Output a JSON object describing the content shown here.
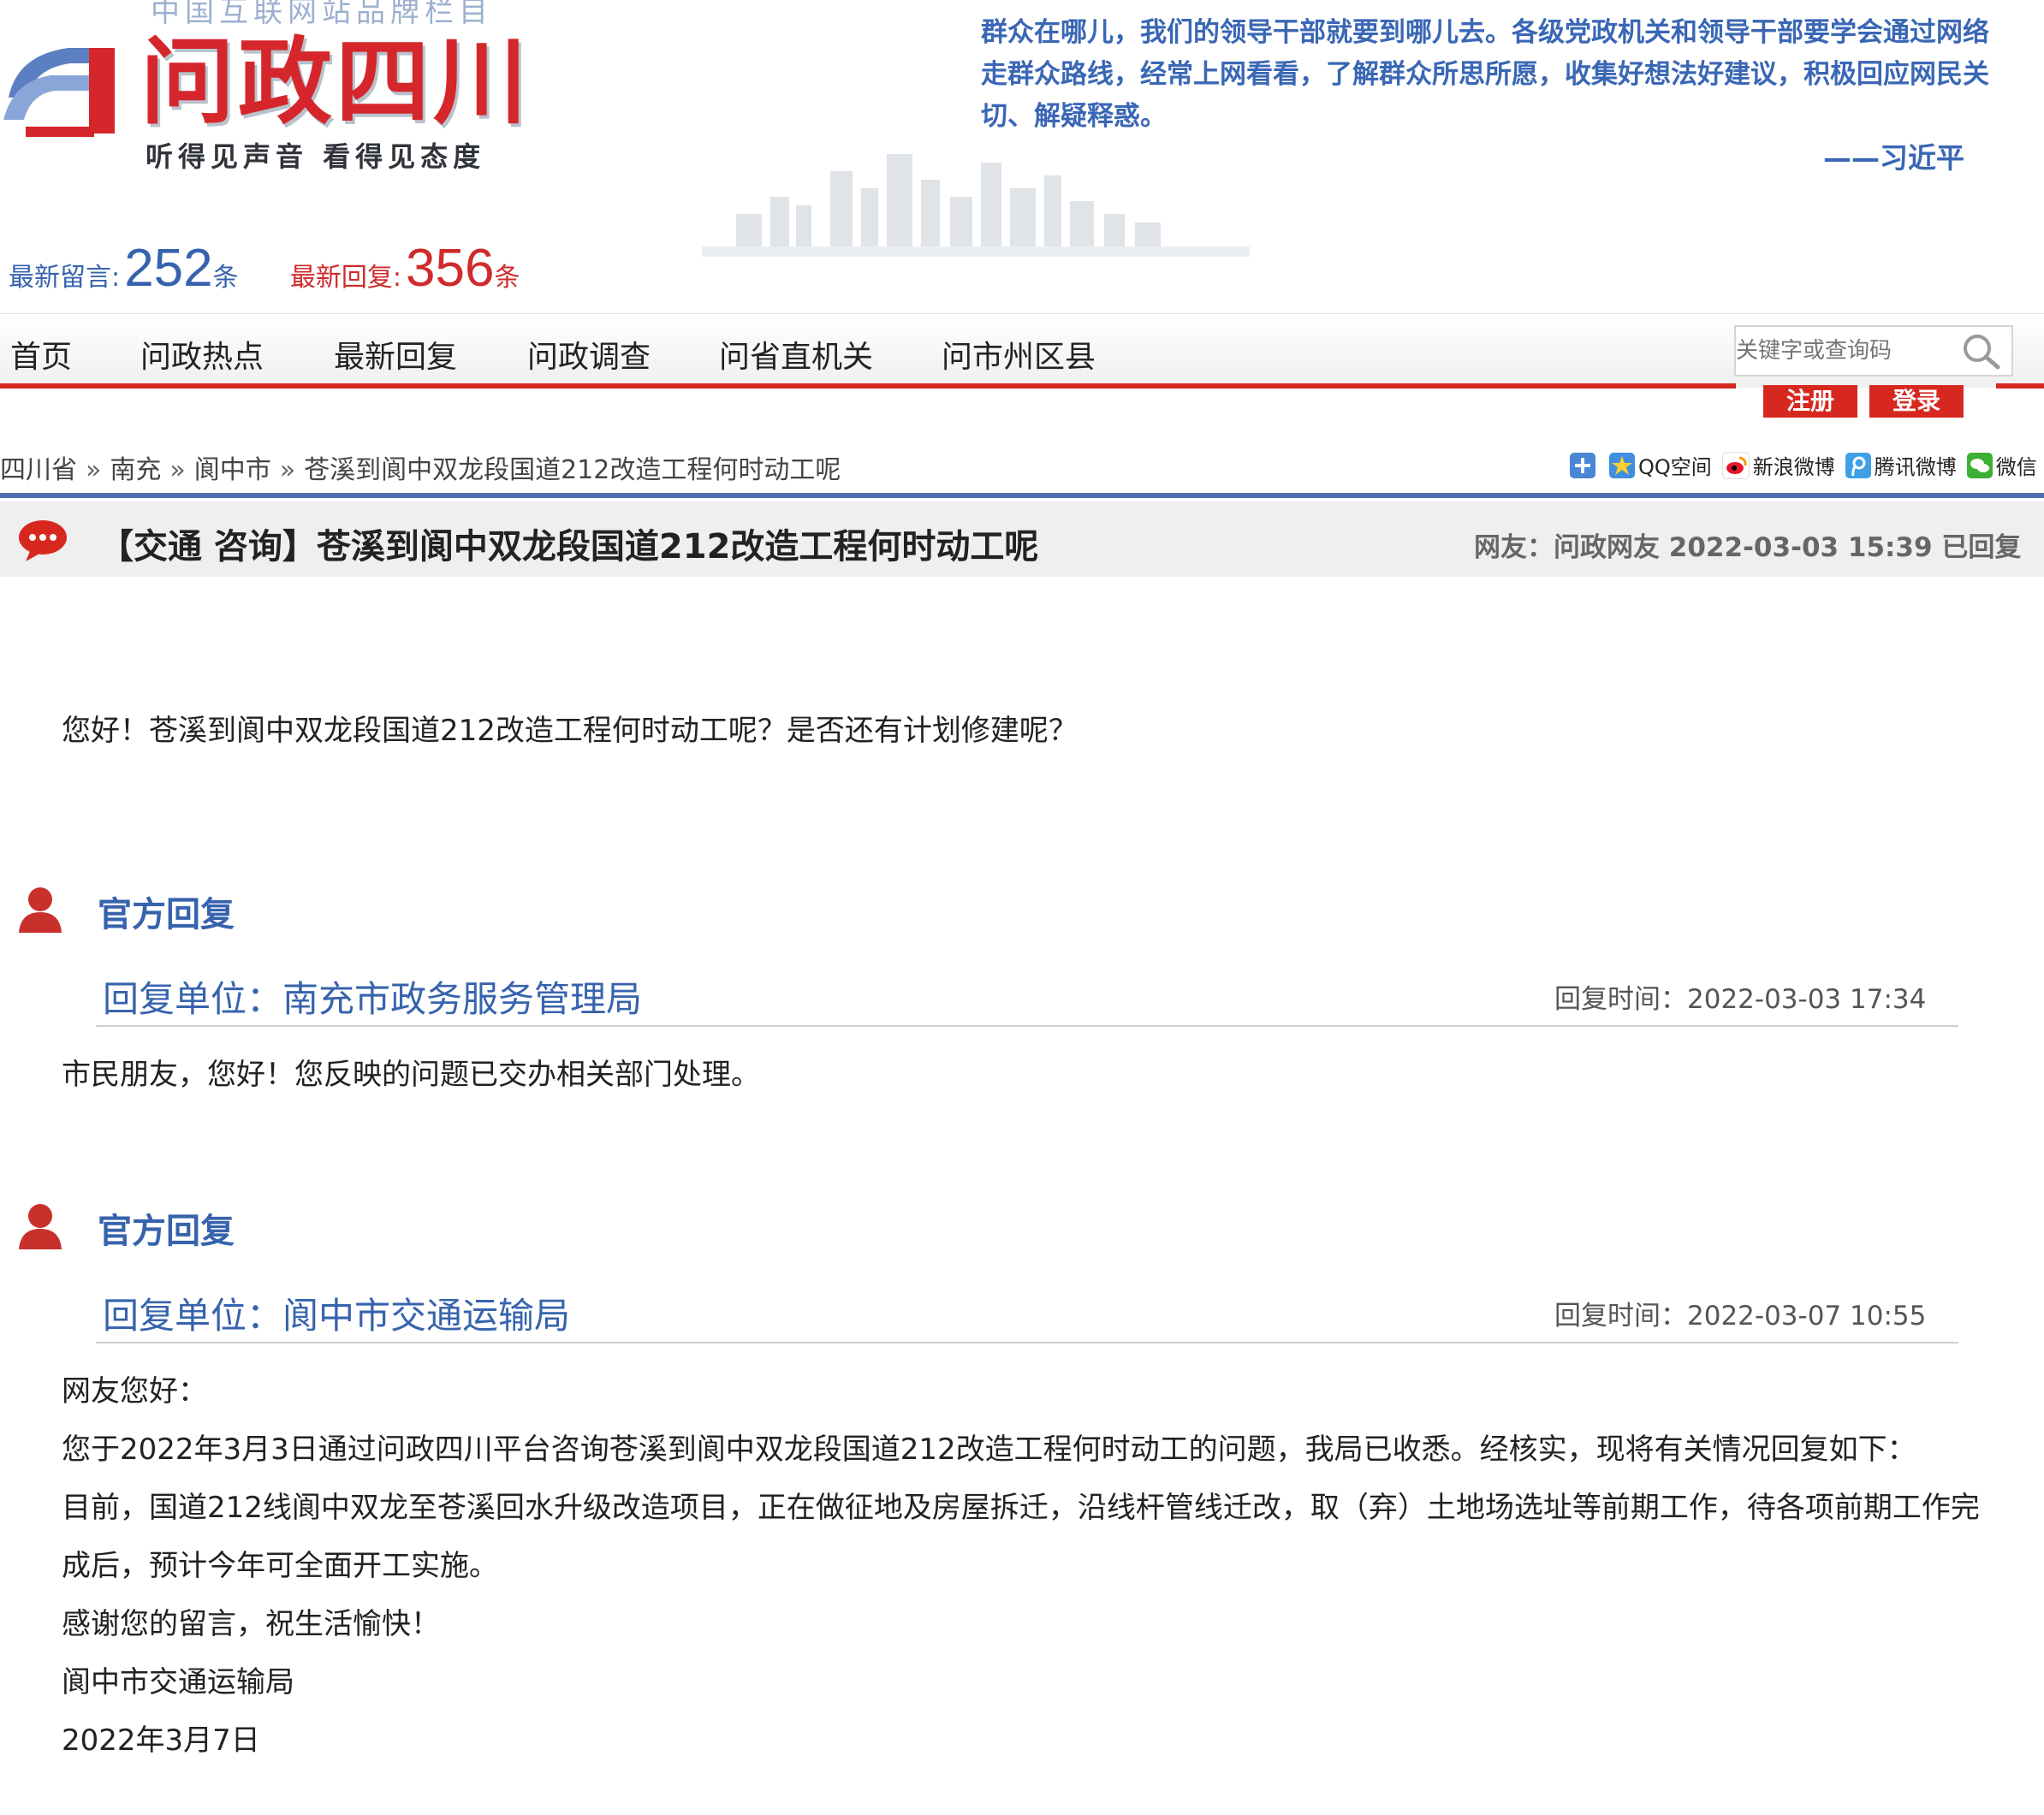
{
  "header": {
    "brand_top": "中国互联网站品牌栏目",
    "brand_title": "问政四川",
    "brand_slogan": "听得见声音  看得见态度",
    "quote": "群众在哪儿，我们的领导干部就要到哪儿去。各级党政机关和领导干部要学会通过网络走群众路线，经常上网看看，了解群众所思所愿，收集好想法好建议，积极回应网民关切、解疑释惑。",
    "quote_author": "——习近平"
  },
  "stats": {
    "messages_label": "最新留言:",
    "messages_count": "252",
    "messages_unit": "条",
    "replies_label": "最新回复:",
    "replies_count": "356",
    "replies_unit": "条"
  },
  "nav": {
    "items": [
      {
        "label": "首页"
      },
      {
        "label": "问政热点"
      },
      {
        "label": "最新回复"
      },
      {
        "label": "问政调查"
      },
      {
        "label": "问省直机关"
      },
      {
        "label": "问市州区县"
      }
    ],
    "search_placeholder": "关键字或查询码",
    "register_label": "注册",
    "login_label": "登录"
  },
  "breadcrumb": {
    "items": [
      "四川省",
      "南充",
      "阆中市",
      "苍溪到阆中双龙段国道212改造工程何时动工呢"
    ],
    "separator": "»"
  },
  "share": {
    "items": [
      {
        "label": "",
        "icon": "plus-icon"
      },
      {
        "label": "QQ空间",
        "icon": "qzone-icon"
      },
      {
        "label": "新浪微博",
        "icon": "weibo-icon"
      },
      {
        "label": "腾讯微博",
        "icon": "tencent-weibo-icon"
      },
      {
        "label": "微信",
        "icon": "wechat-icon"
      }
    ]
  },
  "post": {
    "title": "【交通 咨询】苍溪到阆中双龙段国道212改造工程何时动工呢",
    "meta": "网友：问政网友  2022-03-03 15:39 已回复",
    "question": "您好！苍溪到阆中双龙段国道212改造工程何时动工呢？是否还有计划修建呢？"
  },
  "replies": [
    {
      "head_label": "官方回复",
      "unit": "回复单位：南充市政务服务管理局",
      "time": "回复时间：2022-03-03 17:34",
      "body": [
        "市民朋友，您好！您反映的问题已交办相关部门处理。"
      ]
    },
    {
      "head_label": "官方回复",
      "unit": "回复单位：阆中市交通运输局",
      "time": "回复时间：2022-03-07 10:55",
      "body": [
        "网友您好：",
        "您于2022年3月3日通过问政四川平台咨询苍溪到阆中双龙段国道212改造工程何时动工的问题，我局已收悉。经核实，现将有关情况回复如下：",
        "目前，国道212线阆中双龙至苍溪回水升级改造项目，正在做征地及房屋拆迁，沿线杆管线迁改，取（弃）土地场选址等前期工作，待各项前期工作完成后，预计今年可全面开工实施。",
        "感谢您的留言，祝生活愉快！",
        "阆中市交通运输局",
        "2022年3月7日"
      ]
    }
  ],
  "colors": {
    "brand_red": "#d7281f",
    "brand_blue": "#3763ad",
    "rule_blue": "#4d6fae"
  }
}
